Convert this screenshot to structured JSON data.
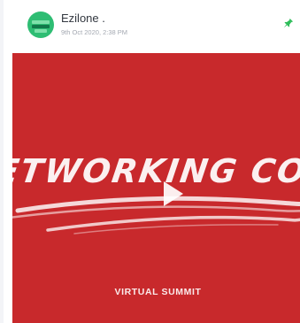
{
  "post": {
    "author": "Ezilone .",
    "timestamp": "9th Oct 2020, 2:38 PM",
    "pin_icon": "pin-icon",
    "pin_color": "#2ebd5a"
  },
  "media": {
    "background_color": "#c8292c",
    "headline": "ETWORKING CONTE",
    "caption": "VIRTUAL SUMMIT",
    "play_icon": "play-icon"
  }
}
